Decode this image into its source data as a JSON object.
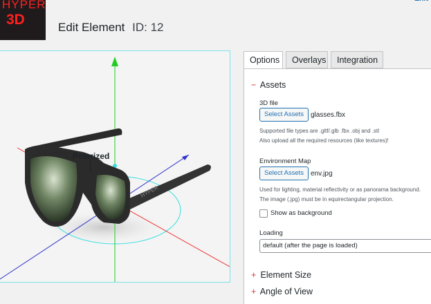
{
  "brand": {
    "line1": "HYPER",
    "line2": "3D",
    "color": "#ff2020",
    "background": "#1f1a1b"
  },
  "header": {
    "title": "Edit Element",
    "id_label": "ID: 12"
  },
  "viewport": {
    "annotation": "Polarized",
    "product_branding": "HYPER",
    "axis_colors": {
      "y": "#22cc22",
      "x": "#ee3333",
      "z": "#3333cc",
      "gizmo": "#33dddd"
    }
  },
  "tabs": [
    {
      "label": "Options",
      "active": true
    },
    {
      "label": "Overlays",
      "active": false
    },
    {
      "label": "Integration",
      "active": false
    }
  ],
  "assets": {
    "heading": "Assets",
    "expanded_icon": "−",
    "file3d": {
      "label": "3D file",
      "button": "Select Assets",
      "value": "glasses.fbx",
      "hint1": "Supported file types are .gltf/.glb .fbx .obj and .stl",
      "hint2": "Also upload all the required resources (like textures)!"
    },
    "envmap": {
      "label": "Environment Map",
      "button": "Select Assets",
      "value": "env.jpg",
      "hint1": "Used for lighting, material reflectivity or as panorama background.",
      "hint2": "The image (.jpg) must be in equirectangular projection.",
      "checkbox_label": "Show as background",
      "checked": false
    },
    "loading": {
      "label": "Loading",
      "selected": "default (after the page is loaded)"
    }
  },
  "collapsed_sections": [
    {
      "icon": "+",
      "label": "Element Size"
    },
    {
      "icon": "+",
      "label": "Angle of View"
    }
  ]
}
